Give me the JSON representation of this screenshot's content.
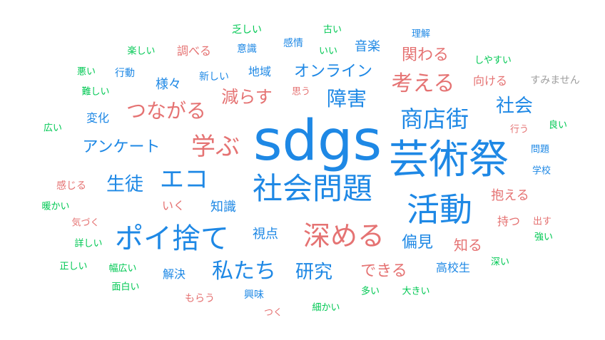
{
  "colors": {
    "blue": "#1e88e5",
    "red": "#e57373",
    "green": "#00c853",
    "gray": "#9e9e9e"
  },
  "words": [
    {
      "text": "sdgs",
      "color": "blue"
    },
    {
      "text": "芸術祭",
      "color": "blue"
    },
    {
      "text": "活動",
      "color": "blue"
    },
    {
      "text": "社会問題",
      "color": "blue"
    },
    {
      "text": "深める",
      "color": "red"
    },
    {
      "text": "ポイ捨て",
      "color": "blue"
    },
    {
      "text": "商店街",
      "color": "blue"
    },
    {
      "text": "学ぶ",
      "color": "red"
    },
    {
      "text": "エコ",
      "color": "blue"
    },
    {
      "text": "考える",
      "color": "red"
    },
    {
      "text": "私たち",
      "color": "blue"
    },
    {
      "text": "つながる",
      "color": "red"
    },
    {
      "text": "研究",
      "color": "blue"
    },
    {
      "text": "障害",
      "color": "blue"
    },
    {
      "text": "生徒",
      "color": "blue"
    },
    {
      "text": "社会",
      "color": "blue"
    },
    {
      "text": "減らす",
      "color": "red"
    },
    {
      "text": "アンケート",
      "color": "blue"
    },
    {
      "text": "オンライン",
      "color": "blue"
    },
    {
      "text": "できる",
      "color": "red"
    },
    {
      "text": "関わる",
      "color": "red"
    },
    {
      "text": "偏見",
      "color": "blue"
    },
    {
      "text": "知る",
      "color": "red"
    },
    {
      "text": "抱える",
      "color": "red"
    },
    {
      "text": "視点",
      "color": "blue"
    },
    {
      "text": "知識",
      "color": "blue"
    },
    {
      "text": "様々",
      "color": "blue"
    },
    {
      "text": "音楽",
      "color": "blue"
    },
    {
      "text": "地域",
      "color": "blue"
    },
    {
      "text": "持つ",
      "color": "red"
    },
    {
      "text": "高校生",
      "color": "blue"
    },
    {
      "text": "向ける",
      "color": "red"
    },
    {
      "text": "すみません",
      "color": "gray"
    },
    {
      "text": "解決",
      "color": "blue"
    },
    {
      "text": "変化",
      "color": "blue"
    },
    {
      "text": "いく",
      "color": "red"
    },
    {
      "text": "調べる",
      "color": "red"
    },
    {
      "text": "感じる",
      "color": "red"
    },
    {
      "text": "興味",
      "color": "blue"
    },
    {
      "text": "もらう",
      "color": "red"
    },
    {
      "text": "意識",
      "color": "blue"
    },
    {
      "text": "感情",
      "color": "blue"
    },
    {
      "text": "新しい",
      "color": "blue"
    },
    {
      "text": "行動",
      "color": "blue"
    },
    {
      "text": "乏しい",
      "color": "green"
    },
    {
      "text": "古い",
      "color": "green"
    },
    {
      "text": "理解",
      "color": "blue"
    },
    {
      "text": "楽しい",
      "color": "green"
    },
    {
      "text": "いい",
      "color": "green"
    },
    {
      "text": "悪い",
      "color": "green"
    },
    {
      "text": "しやすい",
      "color": "green"
    },
    {
      "text": "難しい",
      "color": "green"
    },
    {
      "text": "思う",
      "color": "red"
    },
    {
      "text": "広い",
      "color": "green"
    },
    {
      "text": "良い",
      "color": "green"
    },
    {
      "text": "行う",
      "color": "red"
    },
    {
      "text": "問題",
      "color": "blue"
    },
    {
      "text": "学校",
      "color": "blue"
    },
    {
      "text": "暖かい",
      "color": "green"
    },
    {
      "text": "気づく",
      "color": "red"
    },
    {
      "text": "出す",
      "color": "red"
    },
    {
      "text": "詳しい",
      "color": "green"
    },
    {
      "text": "強い",
      "color": "green"
    },
    {
      "text": "正しい",
      "color": "green"
    },
    {
      "text": "幅広い",
      "color": "green"
    },
    {
      "text": "深い",
      "color": "green"
    },
    {
      "text": "面白い",
      "color": "green"
    },
    {
      "text": "多い",
      "color": "green"
    },
    {
      "text": "大きい",
      "color": "green"
    },
    {
      "text": "細かい",
      "color": "green"
    },
    {
      "text": "つく",
      "color": "red"
    }
  ]
}
